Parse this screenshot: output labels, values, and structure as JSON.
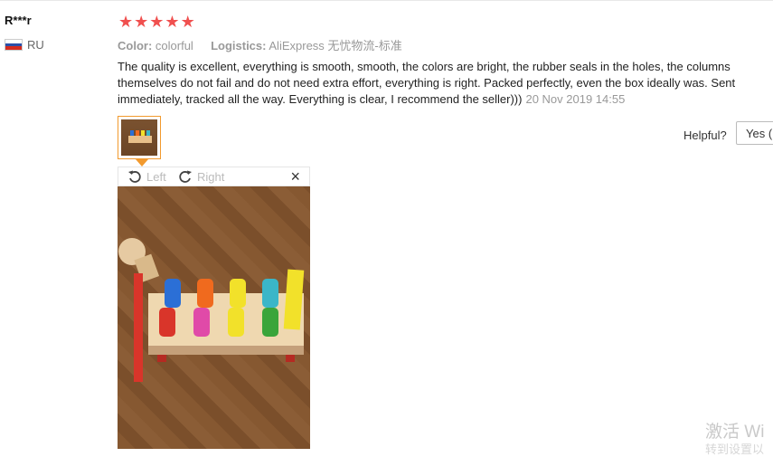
{
  "reviewer": {
    "name": "R***r",
    "country": "RU"
  },
  "rating": {
    "stars": 5,
    "max": 5,
    "color": "#f0504f"
  },
  "meta": {
    "color_label": "Color:",
    "color_value": "colorful",
    "logistics_label": "Logistics:",
    "logistics_value": "AliExpress 无忧物流-标准"
  },
  "review": {
    "text": "The quality is excellent, everything is smooth, smooth, the colors are bright, the rubber seals in the holes, the columns themselves do not fail and do not need extra effort, everything is right. Packed perfectly, even the box ideally was. Sent immediately, tracked all the way. Everything is clear, I recommend the seller)))",
    "date": "20 Nov 2019 14:55"
  },
  "viewer": {
    "rotate_left_label": "Left",
    "rotate_right_label": "Right",
    "close_glyph": "×"
  },
  "helpful": {
    "label": "Helpful?",
    "yes_label": "Yes ("
  },
  "watermark": {
    "line1": "激活 Wi",
    "line2": "转到设置以"
  },
  "colors": {
    "accent": "#f29a2e",
    "star": "#f0504f"
  }
}
